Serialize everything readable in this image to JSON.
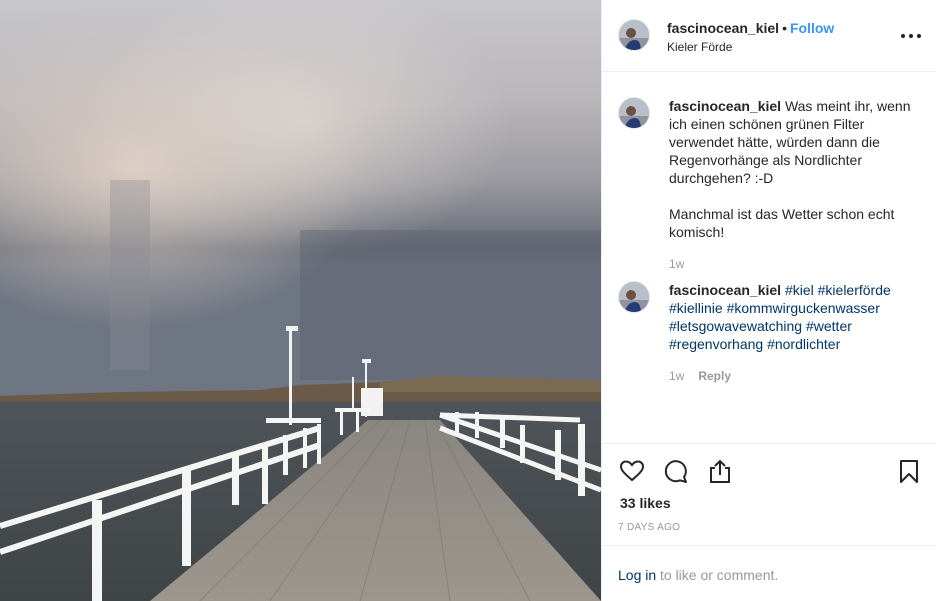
{
  "post": {
    "username": "fascinocean_kiel",
    "separator": "•",
    "follow_label": "Follow",
    "location": "Kieler Förde",
    "more_icon": "more-dots-icon"
  },
  "comments": [
    {
      "username": "fascinocean_kiel",
      "text_p1": "Was meint ihr, wenn ich einen schönen grünen Filter verwendet hätte, würden dann die Regenvorhänge als Nordlichter durchgehen? :-D",
      "text_p2": "Manchmal ist das Wetter schon echt komisch!",
      "age": "1w"
    },
    {
      "username": "fascinocean_kiel",
      "hashtags": [
        "#kiel",
        "#kielerförde",
        "#kiellinie",
        "#kommwirguckenwasser",
        "#letsgowavewatching",
        "#wetter",
        "#regenvorhang",
        "#nordlichter"
      ],
      "age": "1w",
      "reply_label": "Reply"
    }
  ],
  "actions": {
    "like_icon": "heart-icon",
    "comment_icon": "comment-icon",
    "share_icon": "share-icon",
    "save_icon": "bookmark-icon"
  },
  "likes": "33 likes",
  "timestamp": "7 DAYS AGO",
  "login": {
    "link_label": "Log in",
    "rest": "to like or comment."
  }
}
